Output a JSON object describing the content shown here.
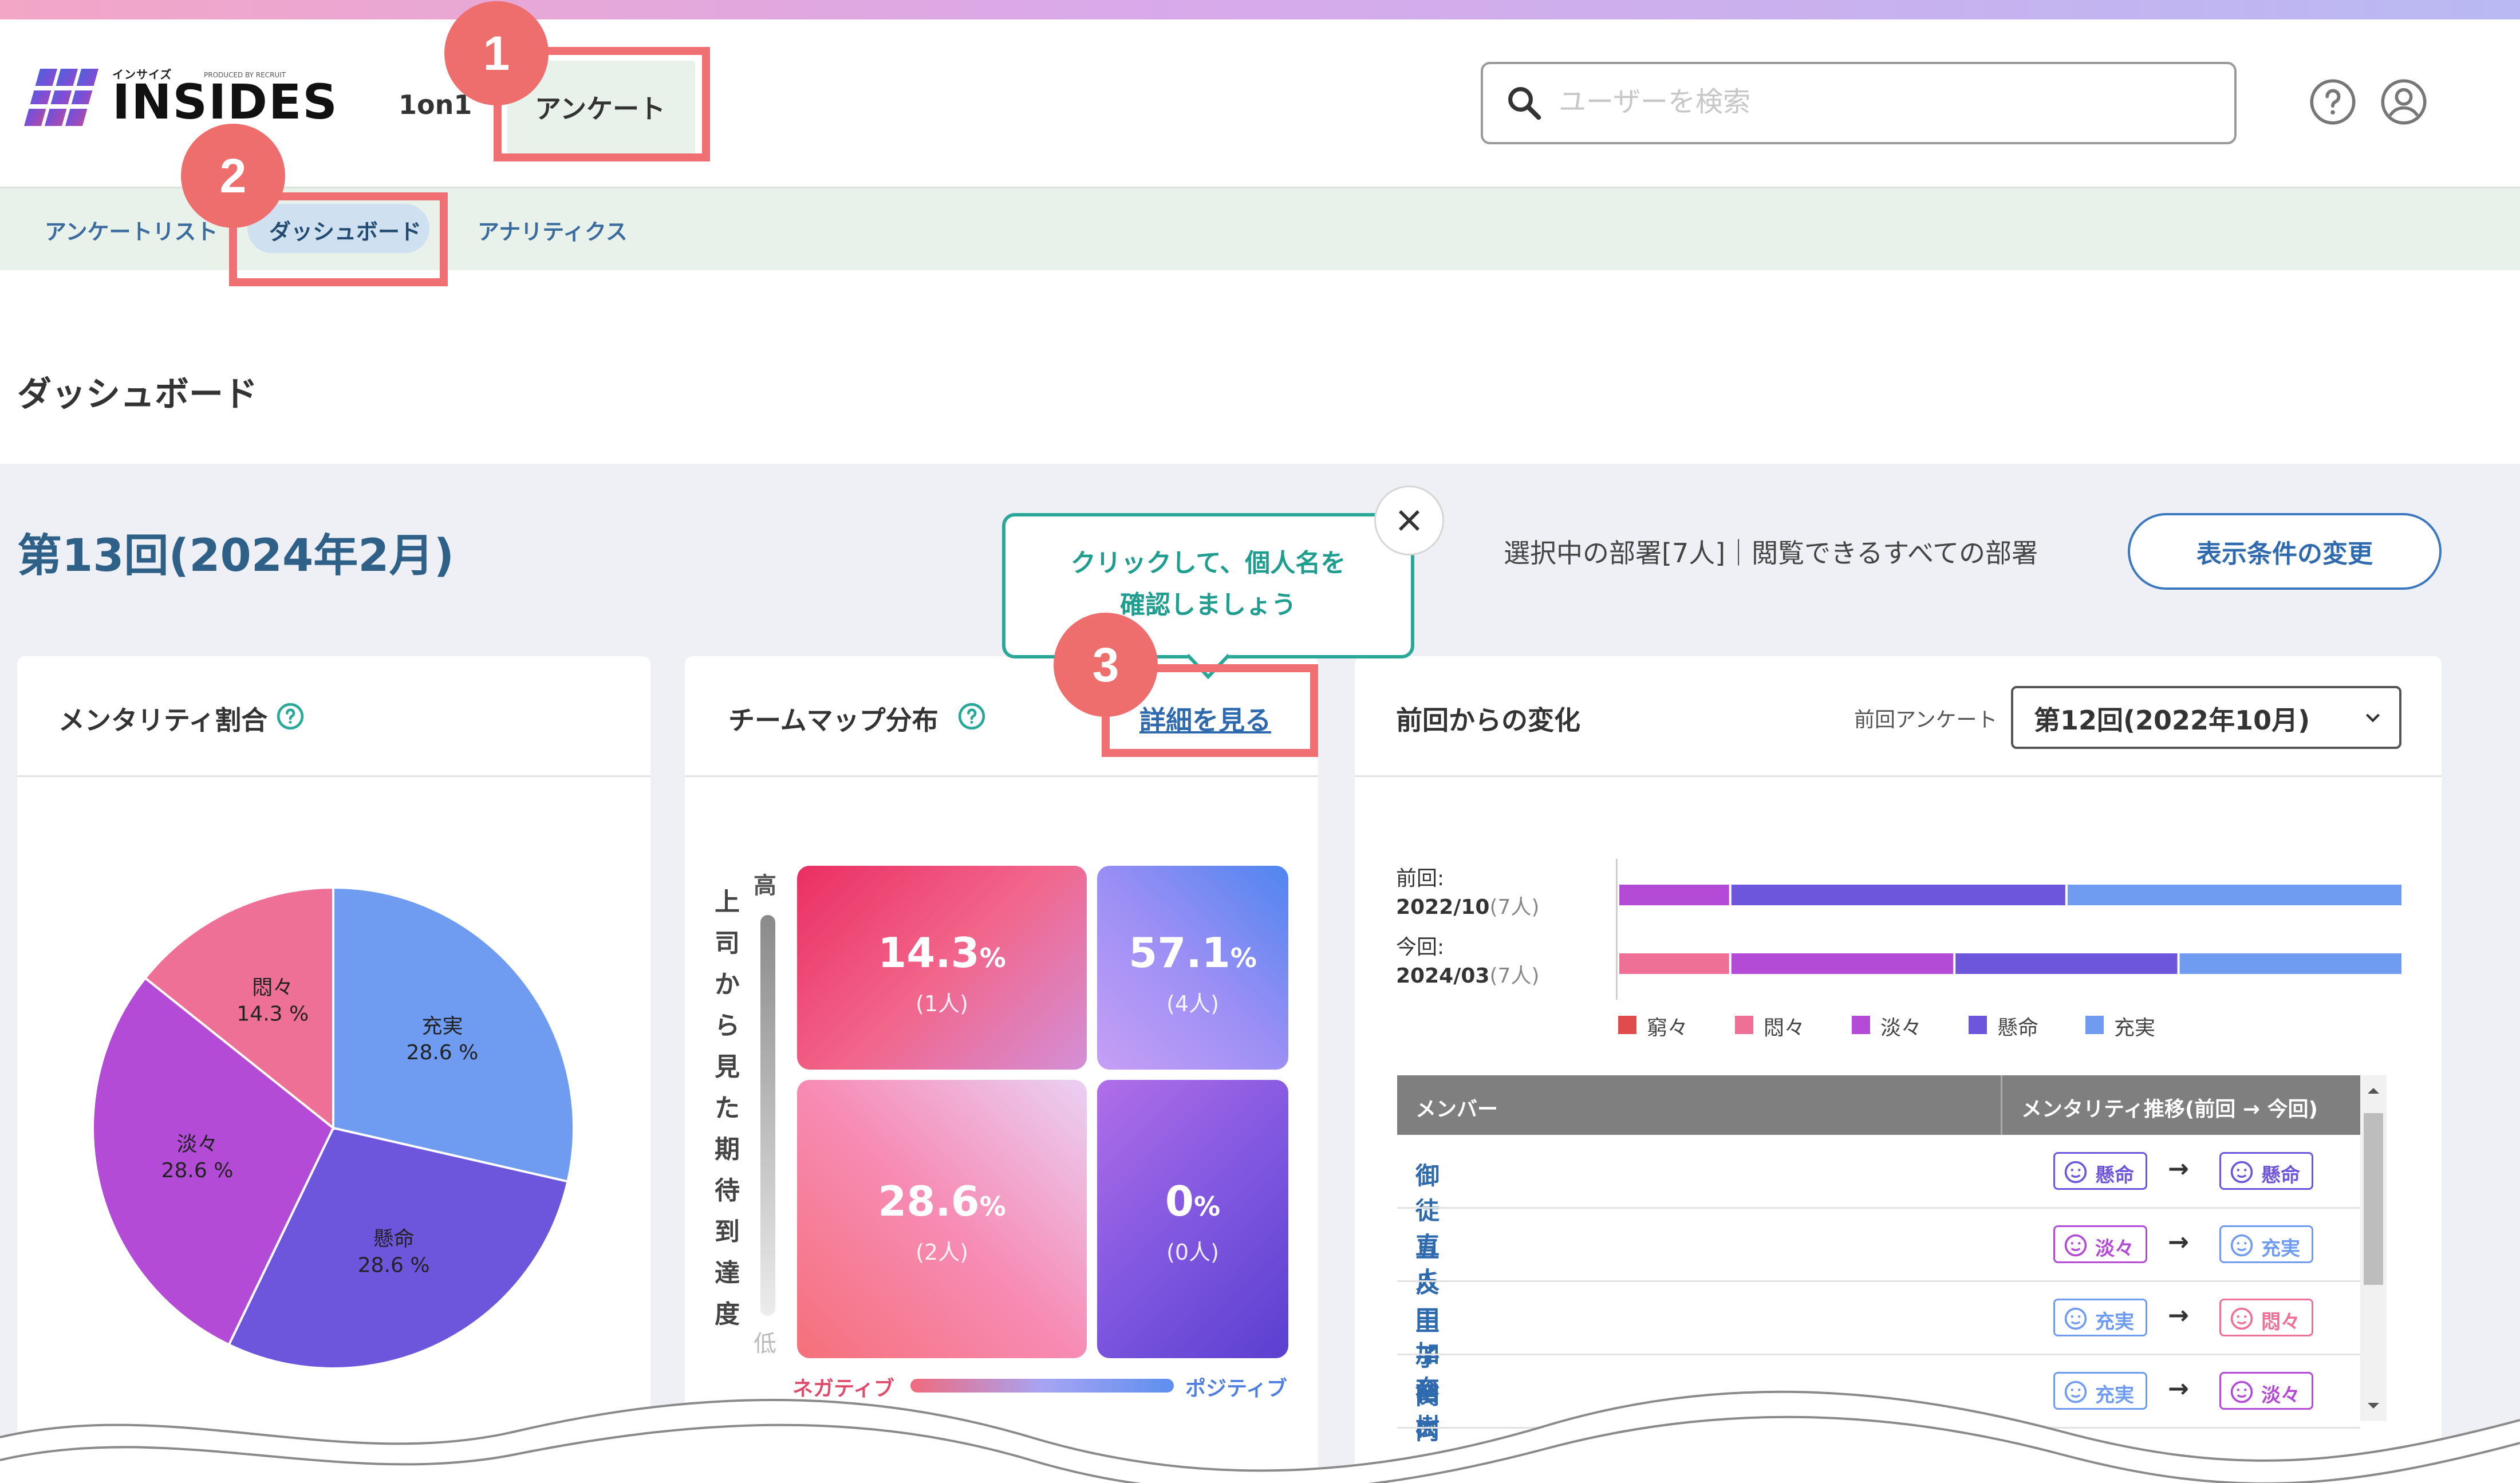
{
  "header": {
    "logo_small": "インサイズ",
    "logo_produced": "PRODUCED BY RECRUIT",
    "logo_text": "INSIDES",
    "nav": [
      {
        "label": "1on1"
      },
      {
        "label": "アンケート"
      }
    ],
    "search": {
      "placeholder": "ユーザーを検索"
    }
  },
  "subnav": {
    "items": [
      {
        "label": "アンケートリスト"
      },
      {
        "label": "ダッシュボード"
      },
      {
        "label": "アナリティクス"
      }
    ]
  },
  "page_title": "ダッシュボード",
  "round_title": "第13回(2024年2月)",
  "dept_text": "選択中の部署[7人]｜閲覧できるすべての部署",
  "condition_button": "表示条件の変更",
  "tooltip": {
    "line1": "クリックして、個人名を",
    "line2": "確認しましょう"
  },
  "steps": [
    "1",
    "2",
    "3"
  ],
  "mentality_card": {
    "title": "メンタリティ割合",
    "chart_data": {
      "type": "pie",
      "slices": [
        {
          "label": "充実",
          "value": 28.6,
          "display": "28.6 %",
          "color": "#6f9cf0"
        },
        {
          "label": "懸命",
          "value": 28.6,
          "display": "28.6 %",
          "color": "#6e56dc"
        },
        {
          "label": "淡々",
          "value": 28.6,
          "display": "28.6 %",
          "color": "#b44bd6"
        },
        {
          "label": "悶々",
          "value": 14.3,
          "display": "14.3 %",
          "color": "#ee7097"
        }
      ]
    }
  },
  "team_card": {
    "title": "チームマップ分布",
    "detail_link": "詳細を見る",
    "y_axis": {
      "high": "高",
      "low": "低",
      "label_chars": [
        "上",
        "司",
        "か",
        "ら",
        "見",
        "た",
        "期",
        "待",
        "到",
        "達",
        "度"
      ]
    },
    "x_axis": {
      "negative": "ネガティブ",
      "positive": "ポジティブ"
    },
    "chart_data": {
      "type": "heatmap",
      "cells": [
        {
          "position": "top-left",
          "percent": "14.3",
          "unit": "%",
          "count": "(1人)"
        },
        {
          "position": "top-right",
          "percent": "57.1",
          "unit": "%",
          "count": "(4人)"
        },
        {
          "position": "bottom-left",
          "percent": "28.6",
          "unit": "%",
          "count": "(2人)"
        },
        {
          "position": "bottom-right",
          "percent": "0",
          "unit": "%",
          "count": "(0人)"
        }
      ]
    }
  },
  "change_card": {
    "title": "前回からの変化",
    "prev_label": "前回アンケート",
    "select_value": "第12回(2022年10月)",
    "chart_data": {
      "type": "bar",
      "stacked": true,
      "orientation": "horizontal",
      "categories": [
        "前回:",
        "今回:"
      ],
      "category_dates": [
        "2022/10",
        "2024/03"
      ],
      "category_counts": [
        "(7人)",
        "(7人)"
      ],
      "series": [
        {
          "name": "窮々",
          "color": "#e04b4b",
          "values": [
            0,
            0
          ]
        },
        {
          "name": "悶々",
          "color": "#ee7097",
          "values": [
            0,
            1
          ]
        },
        {
          "name": "淡々",
          "color": "#b44bd6",
          "values": [
            1,
            2
          ]
        },
        {
          "name": "懸命",
          "color": "#6e56dc",
          "values": [
            3,
            2
          ]
        },
        {
          "name": "充実",
          "color": "#6f9cf0",
          "values": [
            3,
            2
          ]
        }
      ]
    },
    "table": {
      "headers": [
        "メンバー",
        "メンタリティ推移(前回 → 今回)"
      ],
      "arrow": "→",
      "rows": [
        {
          "name": "御徒 直人",
          "prev": "懸命",
          "prev_color": "#6e56dc",
          "curr": "懸命",
          "curr_color": "#6e56dc"
        },
        {
          "name": "五反田 加奈",
          "prev": "淡々",
          "prev_color": "#b44bd6",
          "curr": "充実",
          "curr_color": "#6f9cf0"
        },
        {
          "name": "王子 裕樹",
          "prev": "充実",
          "prev_color": "#6f9cf0",
          "curr": "悶々",
          "curr_color": "#ee7097"
        },
        {
          "name": "関内 香織",
          "prev": "充実",
          "prev_color": "#6f9cf0",
          "curr": "淡々",
          "curr_color": "#b44bd6"
        }
      ]
    }
  }
}
